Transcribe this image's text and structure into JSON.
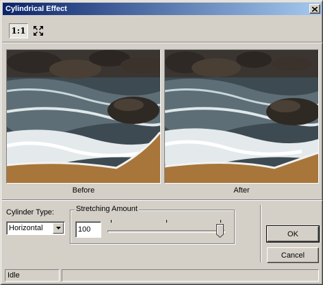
{
  "window": {
    "title": "Cylindrical Effect",
    "close_glyph": "✕"
  },
  "toolbar": {
    "actual_size_label": "1:1",
    "fit_icon": "fit-to-window-icon"
  },
  "previews": {
    "before_caption": "Before",
    "after_caption": "After"
  },
  "controls": {
    "cylinder_type_label": "Cylinder Type:",
    "cylinder_type_value": "Horizontal",
    "stretching_label": "Stretching Amount",
    "stretching_value": "100",
    "slider_level_fraction": 1.0
  },
  "buttons": {
    "ok": "OK",
    "cancel": "Cancel"
  },
  "status": {
    "text": "Idle",
    "secondary": ""
  },
  "colors": {
    "title_start": "#0a246a",
    "title_end": "#a6caf0",
    "face": "#d4d0c8"
  }
}
